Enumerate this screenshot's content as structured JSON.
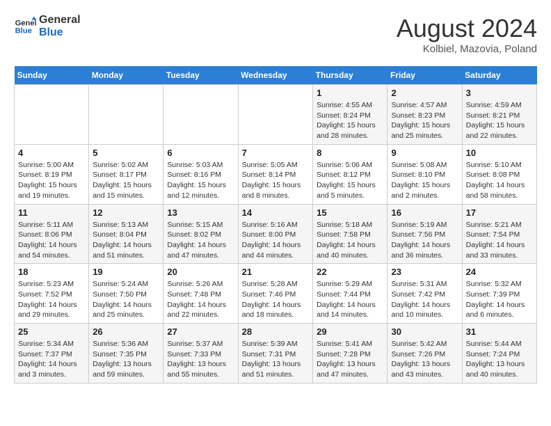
{
  "header": {
    "logo_line1": "General",
    "logo_line2": "Blue",
    "month_title": "August 2024",
    "subtitle": "Kolbiel, Mazovia, Poland"
  },
  "weekdays": [
    "Sunday",
    "Monday",
    "Tuesday",
    "Wednesday",
    "Thursday",
    "Friday",
    "Saturday"
  ],
  "weeks": [
    [
      {
        "day": "",
        "info": ""
      },
      {
        "day": "",
        "info": ""
      },
      {
        "day": "",
        "info": ""
      },
      {
        "day": "",
        "info": ""
      },
      {
        "day": "1",
        "info": "Sunrise: 4:55 AM\nSunset: 8:24 PM\nDaylight: 15 hours\nand 28 minutes."
      },
      {
        "day": "2",
        "info": "Sunrise: 4:57 AM\nSunset: 8:23 PM\nDaylight: 15 hours\nand 25 minutes."
      },
      {
        "day": "3",
        "info": "Sunrise: 4:59 AM\nSunset: 8:21 PM\nDaylight: 15 hours\nand 22 minutes."
      }
    ],
    [
      {
        "day": "4",
        "info": "Sunrise: 5:00 AM\nSunset: 8:19 PM\nDaylight: 15 hours\nand 19 minutes."
      },
      {
        "day": "5",
        "info": "Sunrise: 5:02 AM\nSunset: 8:17 PM\nDaylight: 15 hours\nand 15 minutes."
      },
      {
        "day": "6",
        "info": "Sunrise: 5:03 AM\nSunset: 8:16 PM\nDaylight: 15 hours\nand 12 minutes."
      },
      {
        "day": "7",
        "info": "Sunrise: 5:05 AM\nSunset: 8:14 PM\nDaylight: 15 hours\nand 8 minutes."
      },
      {
        "day": "8",
        "info": "Sunrise: 5:06 AM\nSunset: 8:12 PM\nDaylight: 15 hours\nand 5 minutes."
      },
      {
        "day": "9",
        "info": "Sunrise: 5:08 AM\nSunset: 8:10 PM\nDaylight: 15 hours\nand 2 minutes."
      },
      {
        "day": "10",
        "info": "Sunrise: 5:10 AM\nSunset: 8:08 PM\nDaylight: 14 hours\nand 58 minutes."
      }
    ],
    [
      {
        "day": "11",
        "info": "Sunrise: 5:11 AM\nSunset: 8:06 PM\nDaylight: 14 hours\nand 54 minutes."
      },
      {
        "day": "12",
        "info": "Sunrise: 5:13 AM\nSunset: 8:04 PM\nDaylight: 14 hours\nand 51 minutes."
      },
      {
        "day": "13",
        "info": "Sunrise: 5:15 AM\nSunset: 8:02 PM\nDaylight: 14 hours\nand 47 minutes."
      },
      {
        "day": "14",
        "info": "Sunrise: 5:16 AM\nSunset: 8:00 PM\nDaylight: 14 hours\nand 44 minutes."
      },
      {
        "day": "15",
        "info": "Sunrise: 5:18 AM\nSunset: 7:58 PM\nDaylight: 14 hours\nand 40 minutes."
      },
      {
        "day": "16",
        "info": "Sunrise: 5:19 AM\nSunset: 7:56 PM\nDaylight: 14 hours\nand 36 minutes."
      },
      {
        "day": "17",
        "info": "Sunrise: 5:21 AM\nSunset: 7:54 PM\nDaylight: 14 hours\nand 33 minutes."
      }
    ],
    [
      {
        "day": "18",
        "info": "Sunrise: 5:23 AM\nSunset: 7:52 PM\nDaylight: 14 hours\nand 29 minutes."
      },
      {
        "day": "19",
        "info": "Sunrise: 5:24 AM\nSunset: 7:50 PM\nDaylight: 14 hours\nand 25 minutes."
      },
      {
        "day": "20",
        "info": "Sunrise: 5:26 AM\nSunset: 7:48 PM\nDaylight: 14 hours\nand 22 minutes."
      },
      {
        "day": "21",
        "info": "Sunrise: 5:28 AM\nSunset: 7:46 PM\nDaylight: 14 hours\nand 18 minutes."
      },
      {
        "day": "22",
        "info": "Sunrise: 5:29 AM\nSunset: 7:44 PM\nDaylight: 14 hours\nand 14 minutes."
      },
      {
        "day": "23",
        "info": "Sunrise: 5:31 AM\nSunset: 7:42 PM\nDaylight: 14 hours\nand 10 minutes."
      },
      {
        "day": "24",
        "info": "Sunrise: 5:32 AM\nSunset: 7:39 PM\nDaylight: 14 hours\nand 6 minutes."
      }
    ],
    [
      {
        "day": "25",
        "info": "Sunrise: 5:34 AM\nSunset: 7:37 PM\nDaylight: 14 hours\nand 3 minutes."
      },
      {
        "day": "26",
        "info": "Sunrise: 5:36 AM\nSunset: 7:35 PM\nDaylight: 13 hours\nand 59 minutes."
      },
      {
        "day": "27",
        "info": "Sunrise: 5:37 AM\nSunset: 7:33 PM\nDaylight: 13 hours\nand 55 minutes."
      },
      {
        "day": "28",
        "info": "Sunrise: 5:39 AM\nSunset: 7:31 PM\nDaylight: 13 hours\nand 51 minutes."
      },
      {
        "day": "29",
        "info": "Sunrise: 5:41 AM\nSunset: 7:28 PM\nDaylight: 13 hours\nand 47 minutes."
      },
      {
        "day": "30",
        "info": "Sunrise: 5:42 AM\nSunset: 7:26 PM\nDaylight: 13 hours\nand 43 minutes."
      },
      {
        "day": "31",
        "info": "Sunrise: 5:44 AM\nSunset: 7:24 PM\nDaylight: 13 hours\nand 40 minutes."
      }
    ]
  ]
}
